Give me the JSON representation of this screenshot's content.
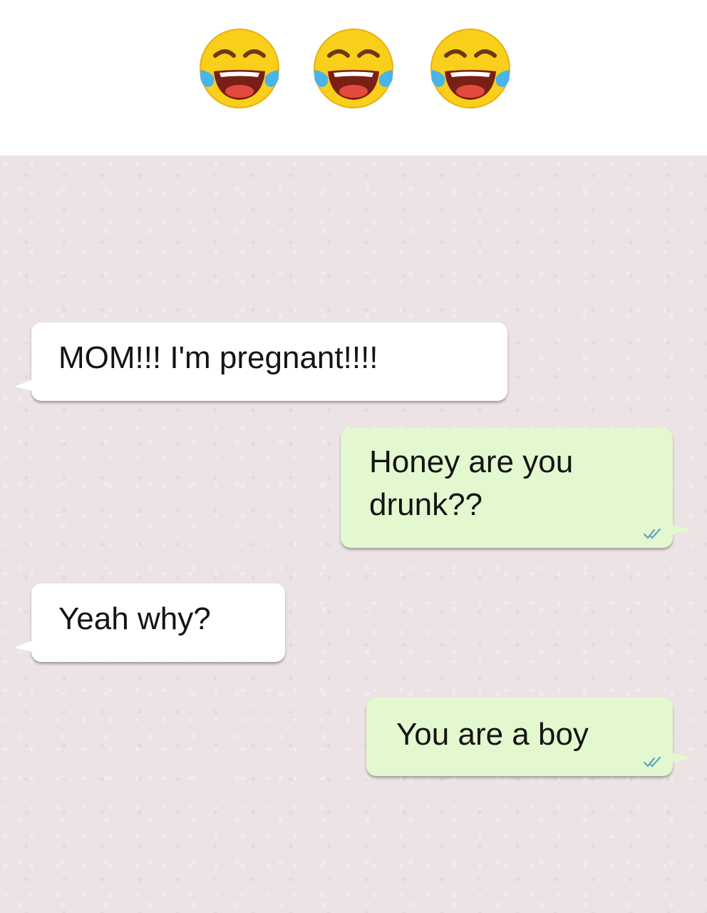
{
  "header": {
    "emojis": [
      "face-with-tears-of-joy",
      "face-with-tears-of-joy",
      "face-with-tears-of-joy"
    ]
  },
  "colors": {
    "chat_background": "#ece3e5",
    "incoming_bubble": "#ffffff",
    "outgoing_bubble": "#e3f8cf",
    "read_ticks": "#5fa7b6"
  },
  "messages": [
    {
      "direction": "incoming",
      "text": "MOM!!! I'm pregnant!!!!"
    },
    {
      "direction": "outgoing",
      "text": "Honey are you drunk??",
      "status": "read"
    },
    {
      "direction": "incoming",
      "text": "Yeah why?"
    },
    {
      "direction": "outgoing",
      "text": "You are a boy",
      "status": "read"
    }
  ]
}
